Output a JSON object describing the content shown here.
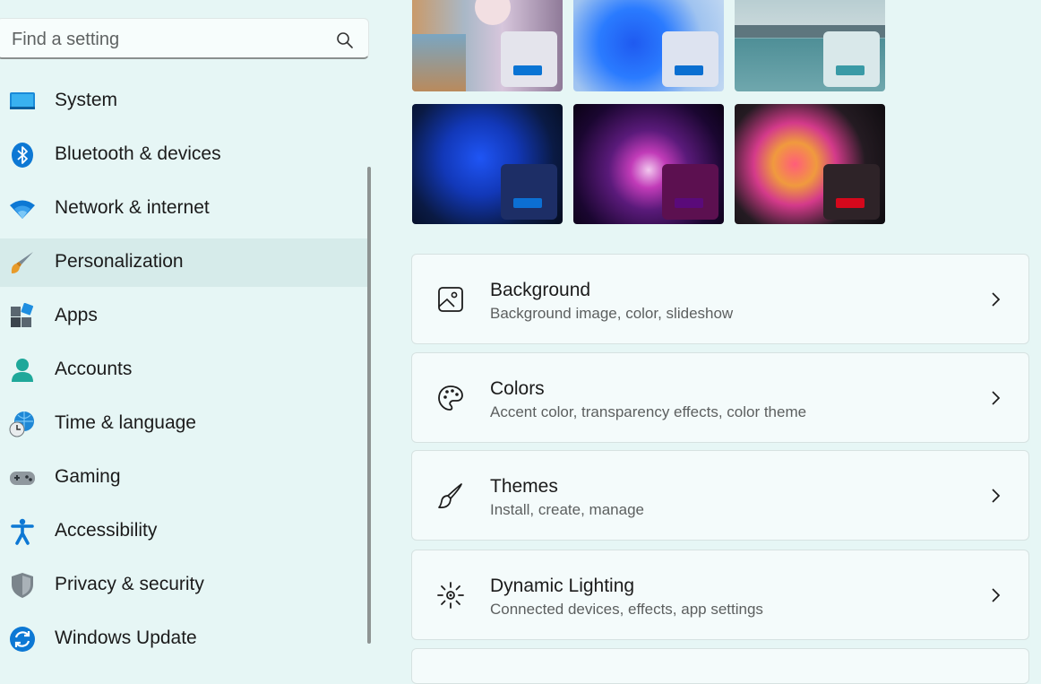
{
  "search": {
    "placeholder": "Find a setting"
  },
  "sidebar": {
    "items": [
      {
        "label": "System",
        "icon": "system-icon"
      },
      {
        "label": "Bluetooth & devices",
        "icon": "bluetooth-icon"
      },
      {
        "label": "Network & internet",
        "icon": "wifi-icon"
      },
      {
        "label": "Personalization",
        "icon": "brush-icon",
        "selected": true
      },
      {
        "label": "Apps",
        "icon": "apps-icon"
      },
      {
        "label": "Accounts",
        "icon": "account-icon"
      },
      {
        "label": "Time & language",
        "icon": "globe-clock-icon"
      },
      {
        "label": "Gaming",
        "icon": "gamepad-icon"
      },
      {
        "label": "Accessibility",
        "icon": "accessibility-icon"
      },
      {
        "label": "Privacy & security",
        "icon": "shield-icon"
      },
      {
        "label": "Windows Update",
        "icon": "update-icon"
      }
    ]
  },
  "themes": [
    {
      "name": "theme-flowers",
      "accent": "#0a74d4"
    },
    {
      "name": "theme-bloom-light",
      "accent": "#0a6fd1"
    },
    {
      "name": "theme-lake",
      "accent": "#3a9aa6"
    },
    {
      "name": "theme-bloom-dark",
      "accent": "#0c6fd3"
    },
    {
      "name": "theme-glow",
      "accent": "#5a0a7a"
    },
    {
      "name": "theme-captured-motion",
      "accent": "#d4081c"
    }
  ],
  "cards": [
    {
      "title": "Background",
      "subtitle": "Background image, color, slideshow",
      "icon": "image-icon"
    },
    {
      "title": "Colors",
      "subtitle": "Accent color, transparency effects, color theme",
      "icon": "palette-icon"
    },
    {
      "title": "Themes",
      "subtitle": "Install, create, manage",
      "icon": "brush-icon"
    },
    {
      "title": "Dynamic Lighting",
      "subtitle": "Connected devices, effects, app settings",
      "icon": "lighting-icon"
    }
  ]
}
